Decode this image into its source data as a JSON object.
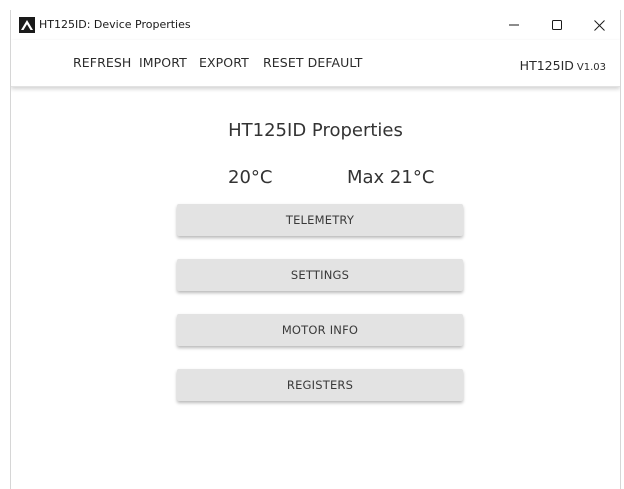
{
  "window": {
    "title": "HT125ID: Device Properties"
  },
  "controls": {
    "minimize": "—",
    "maximize": "☐",
    "close": "✕"
  },
  "menu": {
    "refresh": "REFRESH",
    "import": "IMPORT",
    "export": "EXPORT",
    "reset_default": "RESET DEFAULT",
    "model": "HT125ID",
    "version": "V1.03"
  },
  "main": {
    "title": "HT125ID Properties",
    "temperature": "20°C",
    "max_temperature": "Max 21°C",
    "buttons": {
      "telemetry": "TELEMETRY",
      "settings": "SETTINGS",
      "motor_info": "MOTOR INFO",
      "registers": "REGISTERS"
    }
  },
  "icons": {
    "app": "app-logo-icon",
    "minimize": "minimize-icon",
    "maximize": "maximize-icon",
    "close": "close-icon"
  },
  "colors": {
    "button_bg": "#e3e3e3",
    "text": "#333333",
    "background": "#ffffff"
  }
}
